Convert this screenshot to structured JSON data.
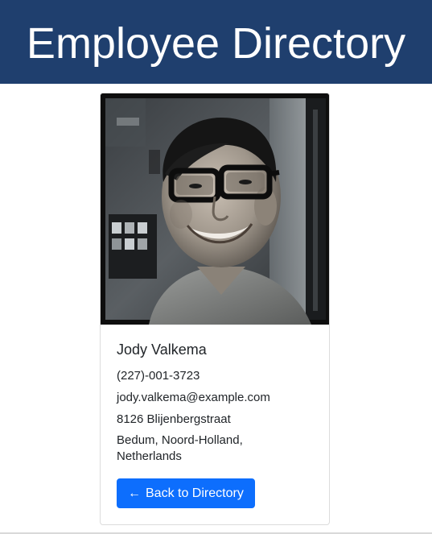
{
  "header": {
    "title": "Employee Directory",
    "background_color": "#1f3f6e"
  },
  "employee": {
    "photo_icon": "employee-photo",
    "name": "Jody Valkema",
    "phone": "(227)-001-3723",
    "email": "jody.valkema@example.com",
    "street": "8126 Blijenbergstraat",
    "city_region_country": "Bedum, Noord-Holland, Netherlands"
  },
  "actions": {
    "back_arrow": "←",
    "back_label": "Back to Directory",
    "button_color": "#0d6efd"
  }
}
